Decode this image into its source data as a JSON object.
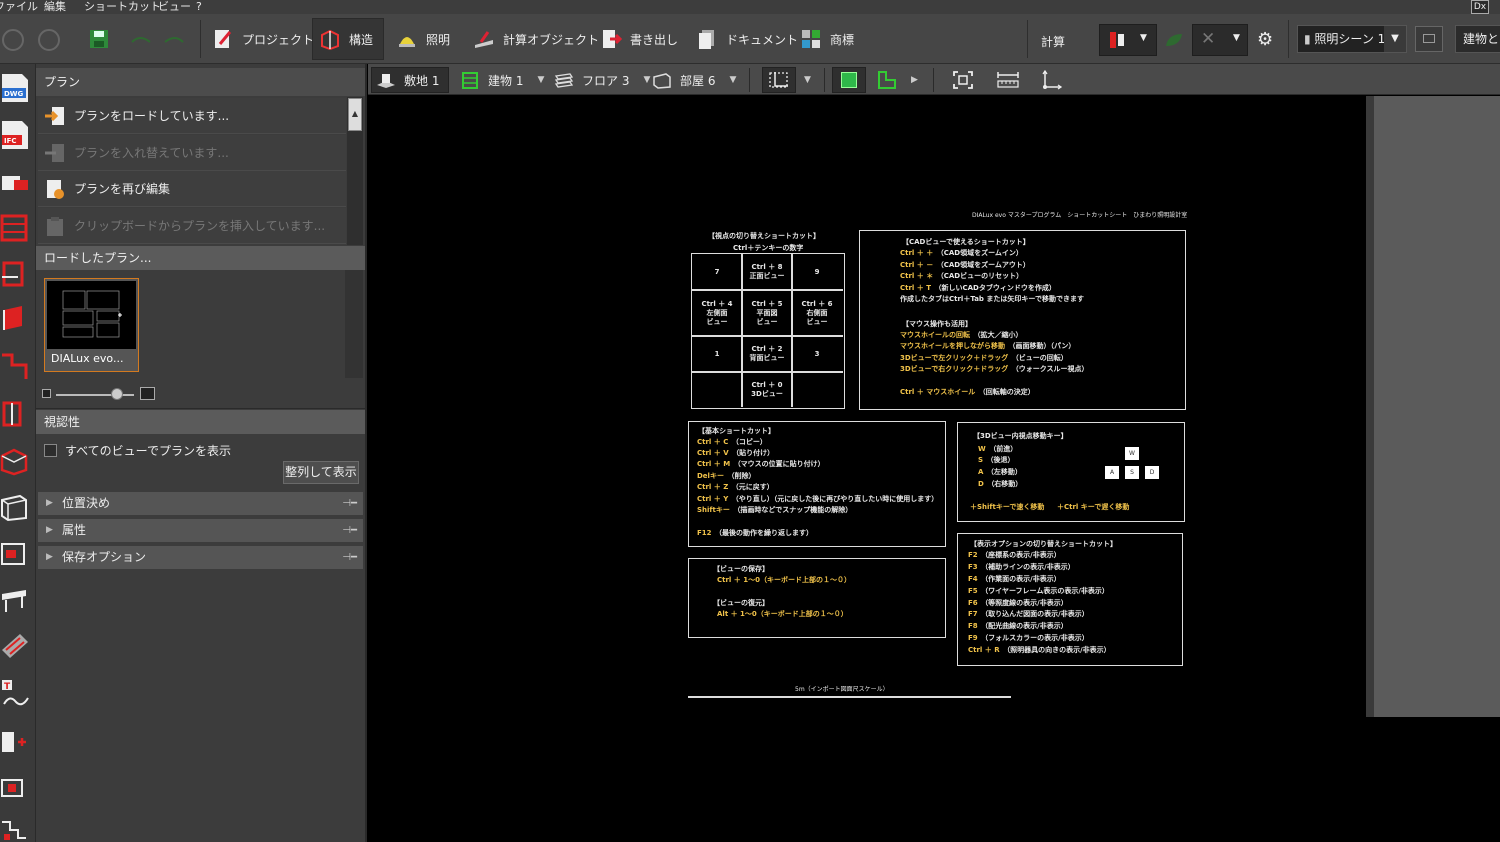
{
  "menubar": {
    "items": [
      "ファイル",
      "編集",
      "ショートカット",
      "ビュー",
      "?"
    ],
    "dx": "Dx"
  },
  "toolbar": {
    "tabs": [
      {
        "label": "プロジェクト",
        "icon": "project-icon"
      },
      {
        "label": "構造",
        "icon": "structure-icon",
        "active": true
      },
      {
        "label": "照明",
        "icon": "lamp-icon"
      },
      {
        "label": "計算オブジェクト",
        "icon": "calc-object-icon"
      },
      {
        "label": "書き出し",
        "icon": "export-icon"
      },
      {
        "label": "ドキュメント",
        "icon": "document-icon"
      },
      {
        "label": "商標",
        "icon": "trademark-icon"
      }
    ],
    "calc_label": "計算",
    "scene": "照明シーン 1",
    "right_button": "建物と"
  },
  "panel": {
    "plan_header": "プラン",
    "plan_items": [
      {
        "label": "プランをロードしています...",
        "enabled": true
      },
      {
        "label": "プランを入れ替えています...",
        "enabled": false
      },
      {
        "label": "プランを再び編集",
        "enabled": true
      },
      {
        "label": "クリップボードからプランを挿入しています...",
        "enabled": false
      }
    ],
    "loaded_header": "ロードしたプラン...",
    "thumb_label": "DIALux evo...",
    "visibility_header": "視認性",
    "show_all_label": "すべてのビューでプランを表示",
    "arrange_button": "整列して表示",
    "sections": [
      "位置決め",
      "属性",
      "保存オプション"
    ]
  },
  "viewbar": {
    "items": [
      {
        "label": "敷地 1"
      },
      {
        "label": "建物 1"
      },
      {
        "label": "フロア 3"
      },
      {
        "label": "部屋 6"
      }
    ]
  },
  "sheet": {
    "header": "DIALux evo マスタープログラム　ショートカットシート　ひまわり照明設計室",
    "view_switch": {
      "title": "【視点の切り替えショートカット】",
      "subtitle": "Ctrl＋テンキーの数字",
      "cells": [
        {
          "lines": [
            "7"
          ],
          "yellow": false
        },
        {
          "lines": [
            "Ctrl ＋ 8",
            "正面ビュー"
          ],
          "yellow": true
        },
        {
          "lines": [
            "9"
          ],
          "yellow": false
        },
        {
          "lines": [
            "Ctrl ＋ 4",
            "左側面",
            "ビュー"
          ],
          "yellow": true
        },
        {
          "lines": [
            "Ctrl ＋ 5",
            "平面図",
            "ビュー"
          ],
          "yellow": true
        },
        {
          "lines": [
            "Ctrl ＋ 6",
            "右側面",
            "ビュー"
          ],
          "yellow": true
        },
        {
          "lines": [
            "1"
          ],
          "yellow": false
        },
        {
          "lines": [
            "Ctrl ＋ 2",
            "背面ビュー"
          ],
          "yellow": true
        },
        {
          "lines": [
            "3"
          ],
          "yellow": false
        },
        {
          "lines": [],
          "yellow": false
        },
        {
          "lines": [
            "Ctrl ＋ 0",
            "3Dビュー"
          ],
          "yellow": true
        },
        {
          "lines": [],
          "yellow": false
        }
      ]
    },
    "cad_view": {
      "title": "【CADビューで使えるショートカット】",
      "lines": [
        {
          "k": "Ctrl ＋ ＋",
          "d": "（CAD領域をズームイン）"
        },
        {
          "k": "Ctrl ＋ －",
          "d": "（CAD領域をズームアウト）"
        },
        {
          "k": "Ctrl ＋ ＊",
          "d": "（CADビューのリセット）"
        },
        {
          "k": "Ctrl ＋ T",
          "d": "（新しいCADタブウィンドウを作成）"
        }
      ],
      "note": "作成したタブはCtrl＋Tab または矢印キーで移動できます",
      "mouse_title": "【マウス操作も活用】",
      "mouse_lines": [
        {
          "k": "マウスホイールの回転",
          "d": "（拡大／縮小）"
        },
        {
          "k": "マウスホイールを押しながら移動",
          "d": "（画面移動）（パン）"
        },
        {
          "k": "3Dビューで左クリック＋ドラッグ",
          "d": "（ビューの回転）"
        },
        {
          "k": "3Dビューで右クリック＋ドラッグ",
          "d": "（ウォークスルー視点）"
        }
      ],
      "last": {
        "k": "Ctrl ＋ マウスホイール",
        "d": "（回転軸の決定）"
      }
    },
    "basic": {
      "title": "【基本ショートカット】",
      "lines": [
        {
          "k": "Ctrl ＋ C",
          "d": "（コピー）"
        },
        {
          "k": "Ctrl ＋ V",
          "d": "（貼り付け）"
        },
        {
          "k": "Ctrl ＋ M",
          "d": "（マウスの位置に貼り付け）"
        },
        {
          "k": "Delキー",
          "d": "（削除）"
        },
        {
          "k": "Ctrl ＋ Z",
          "d": "（元に戻す）"
        },
        {
          "k": "Ctrl ＋ Y",
          "d": "（やり直し）（元に戻した後に再びやり直したい時に使用します）"
        },
        {
          "k": "Shiftキー",
          "d": "（描画時などでスナップ機能の解除）"
        }
      ],
      "last": {
        "k": "F12",
        "d": "（最後の動作を繰り返します）"
      }
    },
    "walk": {
      "title": "【3Dビュー内視点移動キー】",
      "lines": [
        {
          "k": "W",
          "d": "（前進）"
        },
        {
          "k": "S",
          "d": "（後退）"
        },
        {
          "k": "A",
          "d": "（左移動）"
        },
        {
          "k": "D",
          "d": "（右移動）"
        }
      ],
      "keys": [
        "W",
        "A",
        "S",
        "D"
      ],
      "note1": "＋Shiftキーで速く移動",
      "note2": "＋Ctrl キーで遅く移動"
    },
    "display": {
      "title": "【表示オプションの切り替えショートカット】",
      "lines": [
        {
          "k": "F2",
          "d": "（座標系の表示/非表示）"
        },
        {
          "k": "F3",
          "d": "（補助ラインの表示/非表示）"
        },
        {
          "k": "F4",
          "d": "（作業面の表示/非表示）"
        },
        {
          "k": "F5",
          "d": "（ワイヤーフレーム表示の表示/非表示）"
        },
        {
          "k": "F6",
          "d": "（等照度線の表示/非表示）"
        },
        {
          "k": "F7",
          "d": "（取り込んだ図面の表示/非表示）"
        },
        {
          "k": "F8",
          "d": "（配光曲線の表示/非表示）"
        },
        {
          "k": "F9",
          "d": "（フォルスカラーの表示/非表示）"
        },
        {
          "k": "Ctrl ＋ R",
          "d": "（照明器具の向きの表示/非表示）"
        }
      ]
    },
    "save": {
      "title1": "【ビューの保存】",
      "line1": "Ctrl ＋ 1～0（キーボード上部の１～０）",
      "title2": "【ビューの復元】",
      "line2": "Alt ＋ 1～0（キーボード上部の１～０）"
    },
    "scale": "5m（インポート図面尺スケール）"
  }
}
